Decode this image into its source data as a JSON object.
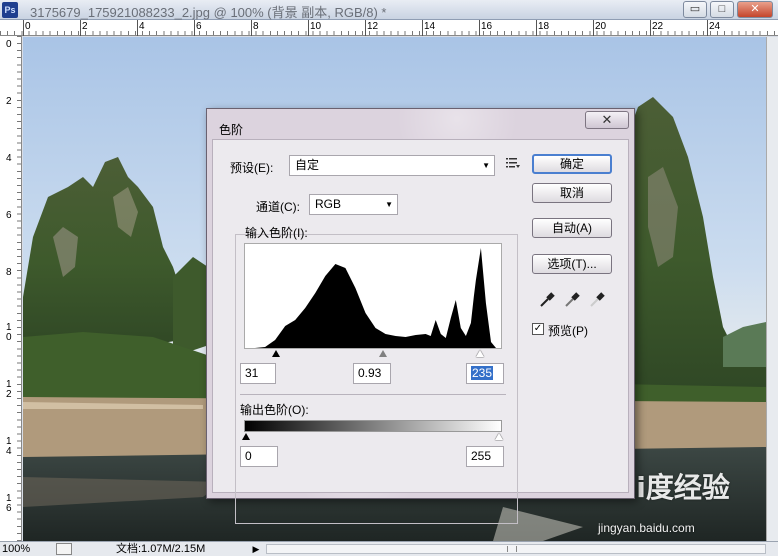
{
  "window": {
    "app_icon": "Ps",
    "title": "3175679_175921088233_2.jpg @ 100% (背景 副本, RGB/8) *",
    "minimize": "▭",
    "maximize": "□",
    "close": "✕"
  },
  "rulers": {
    "top_labels": [
      "0",
      "2",
      "4",
      "6",
      "8",
      "10",
      "12",
      "14",
      "16",
      "18",
      "20",
      "22",
      "24"
    ],
    "left_labels": [
      "0",
      "2",
      "4",
      "6",
      "8",
      "1\n0",
      "1\n2",
      "1\n4",
      "1\n6"
    ]
  },
  "status": {
    "zoom": "100%",
    "doc_info": "文档:1.07M/2.15M",
    "arrow": "▶"
  },
  "dialog": {
    "title": "色阶",
    "close_label": "✕",
    "preset_label": "预设(E):",
    "preset_value": "自定",
    "channel_label": "通道(C):",
    "channel_value": "RGB",
    "input_levels_label": "输入色阶(I):",
    "input_black": "31",
    "input_gamma": "0.93",
    "input_white": "235",
    "output_levels_label": "输出色阶(O):",
    "output_black": "0",
    "output_white": "255",
    "buttons": {
      "ok": "确定",
      "cancel": "取消",
      "auto": "自动(A)",
      "options": "选项(T)..."
    },
    "preview_label": "预览(P)",
    "preview_checked": "✓"
  },
  "watermark": {
    "brand": "Bai度经验",
    "url": "jingyan.baidu.com"
  },
  "chart_data": {
    "type": "area",
    "title": "",
    "xlabel": "",
    "ylabel": "",
    "xlim": [
      0,
      255
    ],
    "ylim": [
      0,
      100
    ],
    "x": [
      0,
      10,
      20,
      30,
      40,
      50,
      60,
      70,
      80,
      90,
      100,
      110,
      120,
      130,
      140,
      150,
      160,
      170,
      180,
      185,
      190,
      195,
      200,
      205,
      210,
      215,
      220,
      225,
      228,
      230,
      235,
      240,
      245,
      250,
      255
    ],
    "values": [
      0,
      0,
      1,
      8,
      22,
      28,
      40,
      55,
      72,
      84,
      80,
      60,
      35,
      20,
      14,
      12,
      11,
      13,
      14,
      12,
      28,
      14,
      10,
      30,
      48,
      20,
      12,
      25,
      52,
      68,
      100,
      45,
      6,
      0,
      0
    ]
  }
}
